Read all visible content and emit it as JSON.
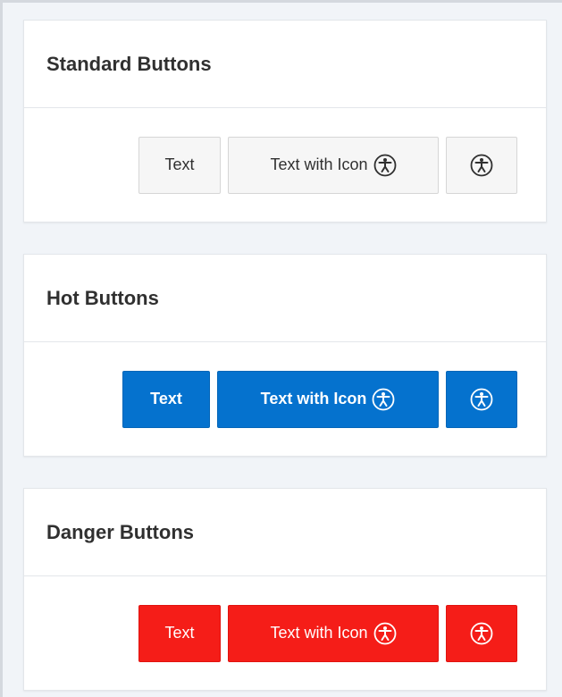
{
  "colors": {
    "hot": "#0572ce",
    "danger": "#f51d18",
    "standard_bg": "#f6f6f6"
  },
  "sections": [
    {
      "title": "Standard Buttons",
      "buttons": {
        "text": "Text",
        "text_with_icon": "Text with Icon",
        "icon": "accessibility-icon"
      }
    },
    {
      "title": "Hot Buttons",
      "buttons": {
        "text": "Text",
        "text_with_icon": "Text with Icon",
        "icon": "accessibility-icon"
      }
    },
    {
      "title": "Danger Buttons",
      "buttons": {
        "text": "Text",
        "text_with_icon": "Text with Icon",
        "icon": "accessibility-icon"
      }
    }
  ]
}
